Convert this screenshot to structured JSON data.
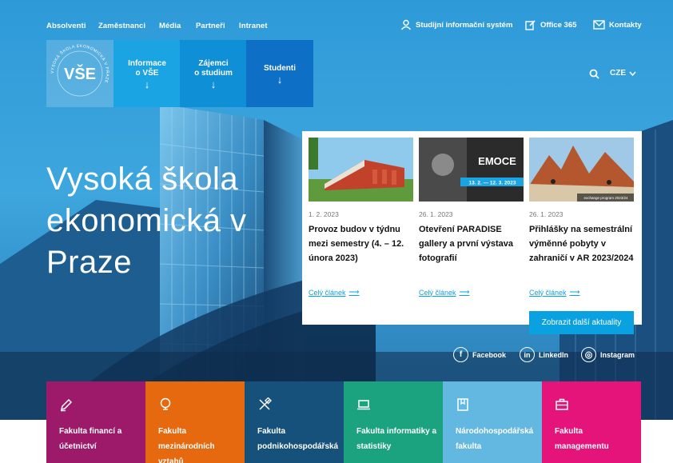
{
  "top_nav": {
    "left_links": [
      "Absolventi",
      "Zaměstnanci",
      "Média",
      "Partneři",
      "Intranet"
    ],
    "right_links": [
      {
        "label": "Studijní informační systém",
        "icon": "user-icon"
      },
      {
        "label": "Office 365",
        "icon": "edit-icon"
      },
      {
        "label": "Kontakty",
        "icon": "mail-icon"
      }
    ]
  },
  "logo": {
    "text": "VŠE",
    "ring_text": "VYSOKÁ ŠKOLA EKONOMICKÁ V PRAZE"
  },
  "main_nav": [
    {
      "label_line1": "Informace",
      "label_line2": "o VŠE",
      "arrow": "↓",
      "color": "#1aa4e3"
    },
    {
      "label_line1": "Zájemci",
      "label_line2": "o studium",
      "arrow": "↓",
      "color": "#0f8fd6"
    },
    {
      "label_line1": "Studenti",
      "label_line2": "",
      "arrow": "↓",
      "color": "#0e6fc6"
    }
  ],
  "lang": {
    "current": "CZE"
  },
  "hero": {
    "title": "Vysoká škola ekonomická v Praze"
  },
  "news": {
    "items": [
      {
        "date": "1. 2. 2023",
        "title": "Provoz budov v týdnu mezi semestry (4. – 12. února 2023)",
        "more": "Celý článek"
      },
      {
        "date": "26. 1. 2023",
        "title": "Otevření PARADISE gallery a první výstava fotografií",
        "more": "Celý článek",
        "img_text": "EMOCE",
        "img_dates": "13. 2. — 12. 3. 2023"
      },
      {
        "date": "26. 1. 2023",
        "title": "Přihlášky na semestrální výměnné pobyty v zahraničí v AR 2023/2024",
        "more": "Celý článek",
        "img_text": "exchange program 2023/24"
      }
    ],
    "more_button": "Zobrazit další aktuality"
  },
  "social": [
    {
      "label": "Facebook",
      "glyph": "f"
    },
    {
      "label": "LinkedIn",
      "glyph": "in"
    },
    {
      "label": "Instagram",
      "glyph": "◎"
    }
  ],
  "faculties": [
    {
      "name": "Fakulta financí a účetnictví",
      "color": "#9d1a6b",
      "icon": "pen-icon"
    },
    {
      "name": "Fakulta mezinárodních vztahů",
      "color": "#e6690f",
      "icon": "bulb-icon"
    },
    {
      "name": "Fakulta podnikohospodářská",
      "color": "#16517c",
      "icon": "tools-icon"
    },
    {
      "name": "Fakulta informatiky a statistiky",
      "color": "#1aa37e",
      "icon": "laptop-icon"
    },
    {
      "name": "Národohospodářská fakulta",
      "color": "#62b8e0",
      "icon": "book-icon"
    },
    {
      "name": "Fakulta managementu",
      "color": "#e4147a",
      "icon": "briefcase-icon"
    }
  ]
}
